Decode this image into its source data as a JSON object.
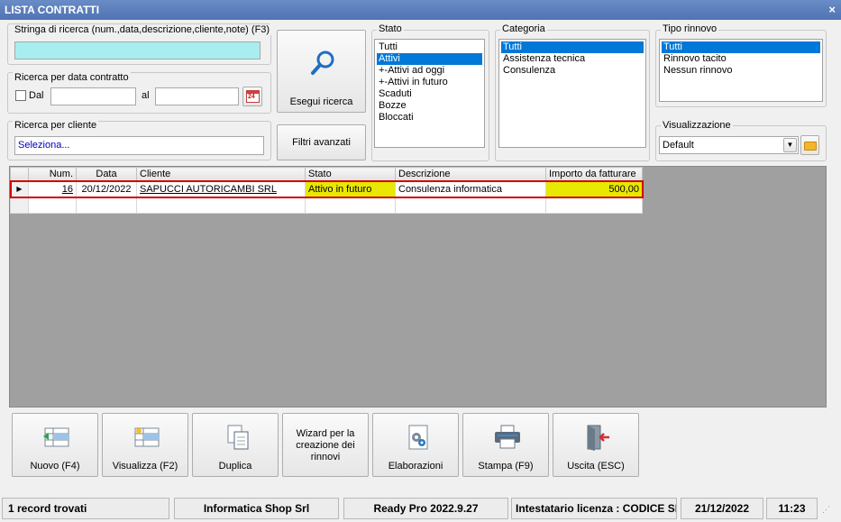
{
  "window": {
    "title": "LISTA CONTRATTI",
    "close": "×"
  },
  "search": {
    "label": "Stringa di ricerca (num.,data,descrizione,cliente,note) (F3)",
    "value": "",
    "date_group": "Ricerca per data contratto",
    "dal_label": "Dal",
    "al_label": "al",
    "cliente_group": "Ricerca per cliente",
    "cliente_value": "Seleziona...",
    "run_button": "Esegui ricerca",
    "advanced_button": "Filtri avanzati",
    "calendar_day": "24"
  },
  "stato": {
    "label": "Stato",
    "items": [
      "Tutti",
      "Attivi",
      "+-Attivi ad oggi",
      "+-Attivi in futuro",
      "Scaduti",
      "Bozze",
      "Bloccati"
    ],
    "selected": 1
  },
  "categoria": {
    "label": "Categoria",
    "items": [
      "Tutti",
      "Assistenza tecnica",
      "Consulenza"
    ],
    "selected": 0
  },
  "rinnovo": {
    "label": "Tipo rinnovo",
    "items": [
      "Tutti",
      "Rinnovo tacito",
      "Nessun rinnovo"
    ],
    "selected": 0
  },
  "visualizzazione": {
    "label": "Visualizzazione",
    "value": "Default"
  },
  "table": {
    "columns": [
      "Num.",
      "Data",
      "Cliente",
      "Stato",
      "Descrizione",
      "Importo da fatturare"
    ],
    "rows": [
      {
        "num": "16",
        "data": "20/12/2022",
        "cliente": "SAPUCCI AUTORICAMBI SRL",
        "stato": "Attivo in futuro",
        "descrizione": "Consulenza informatica",
        "importo": "500,00"
      }
    ]
  },
  "buttons": {
    "nuovo": "Nuovo (F4)",
    "visualizza": "Visualizza (F2)",
    "duplica": "Duplica",
    "wizard": "Wizard per la creazione dei rinnovi",
    "elaborazioni": "Elaborazioni",
    "stampa": "Stampa (F9)",
    "uscita": "Uscita (ESC)"
  },
  "status": {
    "records": "1 record trovati",
    "company": "Informatica Shop Srl",
    "version": "Ready Pro 2022.9.27",
    "license": "Intestatario licenza : CODICE SR",
    "date": "21/12/2022",
    "time": "11:23"
  },
  "colors": {
    "title": "#5a7dbd",
    "search_bg": "#a8eef0",
    "highlight": "#e8e800",
    "row_border": "#d00000",
    "selection": "#0078d7"
  }
}
